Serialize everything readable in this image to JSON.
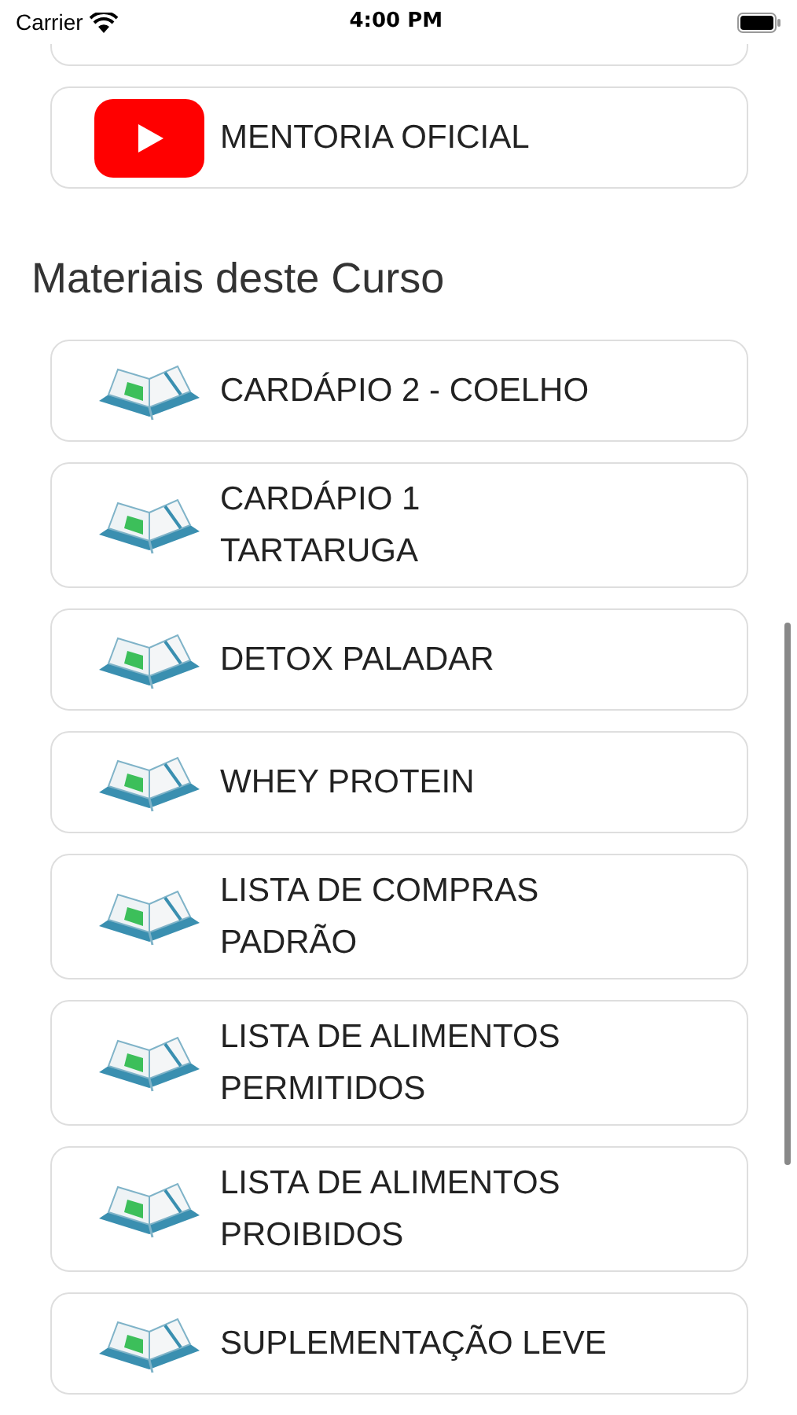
{
  "status_bar": {
    "carrier": "Carrier",
    "time": "4:00 PM"
  },
  "video_links": [
    {
      "label": "MENTORIA OFICIAL"
    }
  ],
  "materials": {
    "title": "Materiais deste Curso",
    "items": [
      {
        "label": "CARDÁPIO 2 - COELHO"
      },
      {
        "label": "CARDÁPIO 1\nTARTARUGA"
      },
      {
        "label": "DETOX PALADAR"
      },
      {
        "label": "WHEY PROTEIN"
      },
      {
        "label": "LISTA DE COMPRAS\nPADRÃO"
      },
      {
        "label": "LISTA DE ALIMENTOS\nPERMITIDOS"
      },
      {
        "label": "LISTA DE ALIMENTOS\nPROIBIDOS"
      },
      {
        "label": "SUPLEMENTAÇÃO LEVE"
      }
    ]
  }
}
